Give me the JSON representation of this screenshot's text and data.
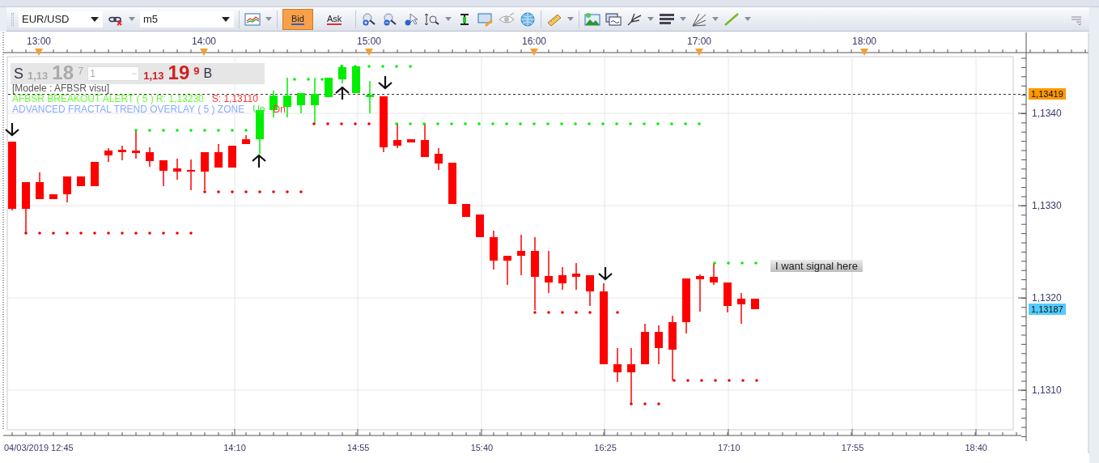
{
  "toolbar": {
    "symbol": "EUR/USD",
    "timeframe": "m5",
    "price_buttons": [
      {
        "label": "Bid",
        "selected": true
      },
      {
        "label": "Ask",
        "selected": false
      }
    ]
  },
  "time_axis_top": [
    "13:00",
    "14:00",
    "15:00",
    "16:00",
    "17:00",
    "18:00"
  ],
  "quote_panel": {
    "sell_label": "S",
    "sell_big": "1,13",
    "sell_pips": "18",
    "sell_fraction": "7",
    "lot": "1",
    "buy_big": "1,13",
    "buy_pips": "19",
    "buy_fraction": "9",
    "buy_label": "B"
  },
  "indicator_lines": [
    {
      "segments": [
        {
          "text": "[Modele : AFBSR visu]",
          "color": "#555555"
        }
      ]
    },
    {
      "segments": [
        {
          "text": "AFBSR BREAKOUT ALERT ( 5 )  R: 1,13230",
          "color": "#66ff33"
        },
        {
          "text": "S: 1,13110",
          "color": "#ff3333"
        }
      ]
    },
    {
      "segments": [
        {
          "text": "ADVANCED FRACTAL TREND OVERLAY ( 5 ) ZONE",
          "color": "#88aaff"
        },
        {
          "text": "Up",
          "color": "#33ee33"
        },
        {
          "text": "Dn",
          "color": "#ff3333"
        }
      ]
    }
  ],
  "annotation": "I want signal here",
  "price_axis": {
    "ticks": [
      "1,1340",
      "1,1330",
      "1,1320",
      "1,1310"
    ],
    "markers": [
      {
        "text": "1,13419",
        "color": "#ff9900"
      },
      {
        "text": "1,13187",
        "color": "#55ccff"
      }
    ]
  },
  "time_axis_bottom": [
    "04/03/2019 12:45",
    "14:10",
    "14:55",
    "15:40",
    "16:25",
    "17:10",
    "17:55",
    "18:40"
  ]
}
